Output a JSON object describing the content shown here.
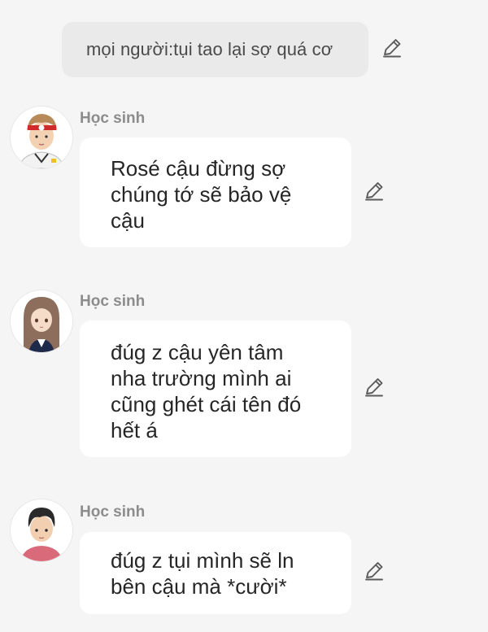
{
  "narration": {
    "text": "mọi người:tụi tao lại sợ quá cơ"
  },
  "messages": [
    {
      "sender": "Học sinh",
      "avatar_icon": "boy-red-headband-avatar",
      "lines": [
        "Rosé cậu đừng sợ",
        "chúng tớ sẽ bảo vệ",
        "cậu"
      ]
    },
    {
      "sender": "Học sinh",
      "avatar_icon": "girl-long-brown-hair-avatar",
      "lines": [
        "đúg z cậu yên tâm",
        "nha trường mình ai",
        "cũng ghét cái tên đó",
        "hết á"
      ]
    },
    {
      "sender": "Học sinh",
      "avatar_icon": "boy-dark-hair-avatar",
      "lines": [
        "đúg z tụi mình sẽ ln",
        "bên cậu mà *cười*"
      ]
    }
  ],
  "colors": {
    "background": "#f5f5f5",
    "narration_bubble": "#eaeaea",
    "message_bubble": "#ffffff",
    "sender_name": "#8c8c8c",
    "text": "#262626",
    "edit_icon": "#5a5a5a"
  },
  "icons": {
    "edit": "pencil-edit-icon"
  }
}
